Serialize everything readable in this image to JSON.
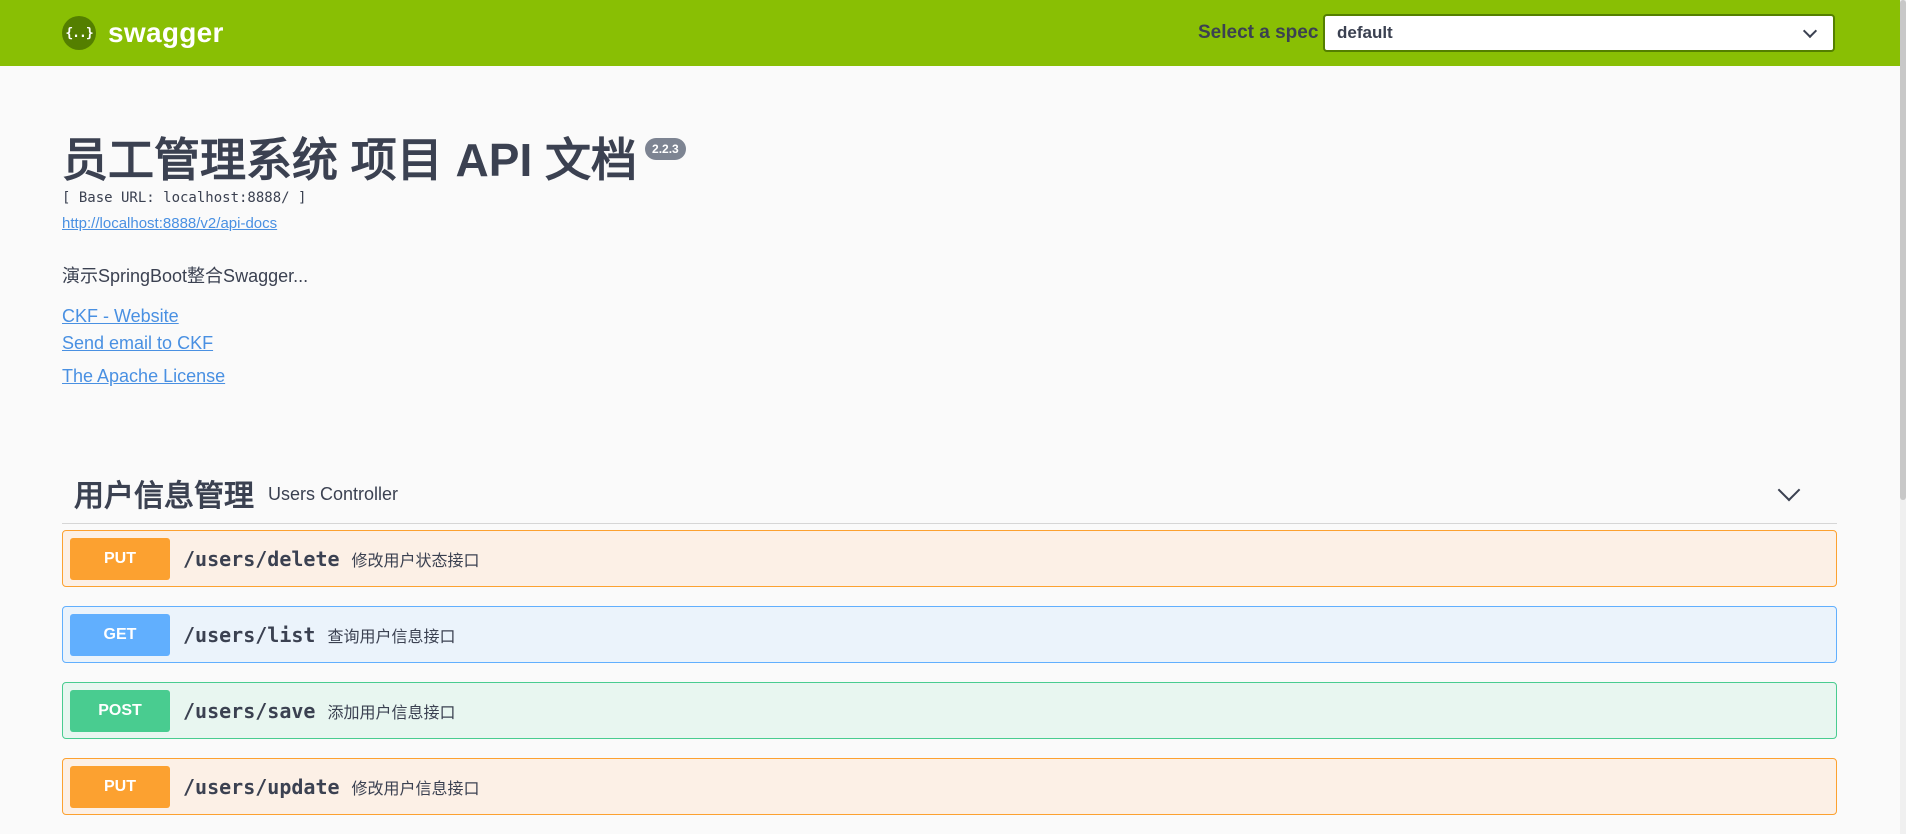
{
  "topbar": {
    "brand_symbol": "{..}",
    "brand_text": "swagger",
    "spec_label": "Select a spec",
    "spec_selected": "default"
  },
  "info": {
    "title": "员工管理系统 项目 API 文档",
    "version": "2.2.3",
    "base_url": "[ Base URL: localhost:8888/ ]",
    "docs_link": "http://localhost:8888/v2/api-docs",
    "description": "演示SpringBoot整合Swagger...",
    "links": [
      {
        "label": "CKF - Website"
      },
      {
        "label": "Send email to CKF"
      },
      {
        "label": "The Apache License"
      }
    ]
  },
  "tag": {
    "name": "用户信息管理",
    "description": "Users Controller"
  },
  "operations": [
    {
      "method": "PUT",
      "path": "/users/delete",
      "summary": "修改用户状态接口"
    },
    {
      "method": "GET",
      "path": "/users/list",
      "summary": "查询用户信息接口"
    },
    {
      "method": "POST",
      "path": "/users/save",
      "summary": "添加用户信息接口"
    },
    {
      "method": "PUT",
      "path": "/users/update",
      "summary": "修改用户信息接口"
    }
  ],
  "colors": {
    "topbar": "#89bf04",
    "put": "#fca130",
    "get": "#61affe",
    "post": "#49cc90",
    "link": "#4990e2"
  }
}
